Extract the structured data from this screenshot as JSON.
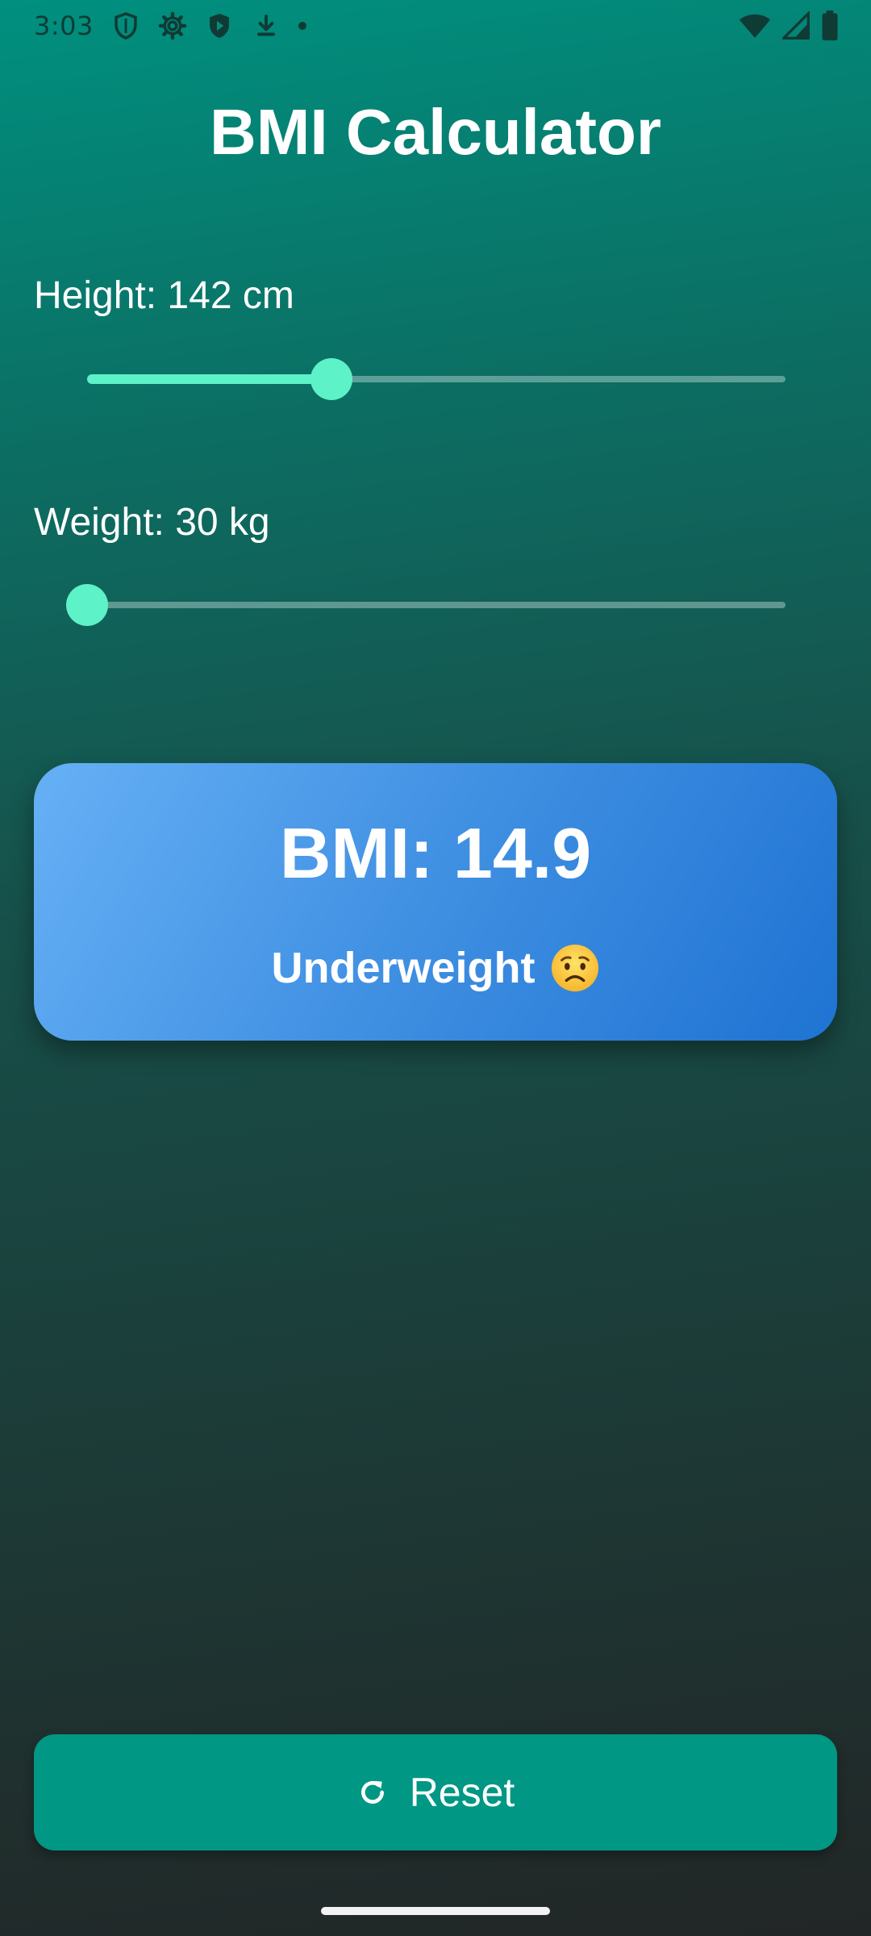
{
  "status_bar": {
    "time": "3:03",
    "icons_left": [
      "shield-icon",
      "gear-icon",
      "play-protect-icon",
      "download-icon",
      "dot-icon"
    ],
    "icons_right": [
      "wifi-icon",
      "signal-icon",
      "battery-icon"
    ]
  },
  "app": {
    "title": "BMI Calculator"
  },
  "height": {
    "label": "Height: 142 cm",
    "value": 142,
    "unit": "cm",
    "slider_fraction": 0.35
  },
  "weight": {
    "label": "Weight: 30 kg",
    "value": 30,
    "unit": "kg",
    "slider_fraction": 0.0
  },
  "result": {
    "bmi_label": "BMI: 14.9",
    "category": "Underweight",
    "emoji_icon": "worried-face-icon"
  },
  "reset": {
    "label": "Reset",
    "icon": "refresh-icon"
  },
  "colors": {
    "accent": "#5df2c8",
    "card_start": "#66b0f5",
    "card_end": "#1f73d2",
    "button": "#009784"
  }
}
